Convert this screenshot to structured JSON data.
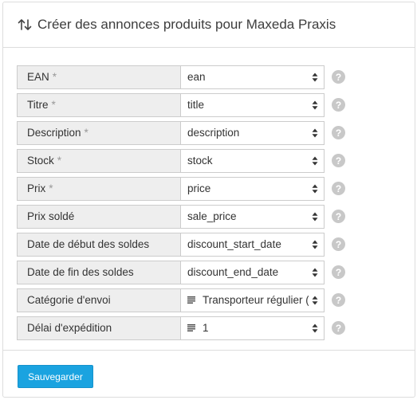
{
  "header": {
    "title": "Créer des annonces produits pour Maxeda Praxis",
    "icon": "sort-arrows-icon"
  },
  "required_marker": "*",
  "help_marker": "?",
  "fields": [
    {
      "label": "EAN",
      "required": true,
      "value": "ean",
      "list_icon": false
    },
    {
      "label": "Titre",
      "required": true,
      "value": "title",
      "list_icon": false
    },
    {
      "label": "Description",
      "required": true,
      "value": "description",
      "list_icon": false
    },
    {
      "label": "Stock",
      "required": true,
      "value": "stock",
      "list_icon": false
    },
    {
      "label": "Prix",
      "required": true,
      "value": "price",
      "list_icon": false
    },
    {
      "label": "Prix soldé",
      "required": false,
      "value": "sale_price",
      "list_icon": false
    },
    {
      "label": "Date de début des soldes",
      "required": false,
      "value": "discount_start_date",
      "list_icon": false
    },
    {
      "label": "Date de fin des soldes",
      "required": false,
      "value": "discount_end_date",
      "list_icon": false
    },
    {
      "label": "Catégorie d'envoi",
      "required": false,
      "value": "Transporteur régulier (",
      "list_icon": true
    },
    {
      "label": "Délai d'expédition",
      "required": false,
      "value": "1",
      "list_icon": true
    }
  ],
  "footer": {
    "save_label": "Sauvegarder"
  },
  "colors": {
    "accent": "#1aa3e0",
    "label_bg": "#eeeeee",
    "help_bg": "#c8c8c8"
  }
}
